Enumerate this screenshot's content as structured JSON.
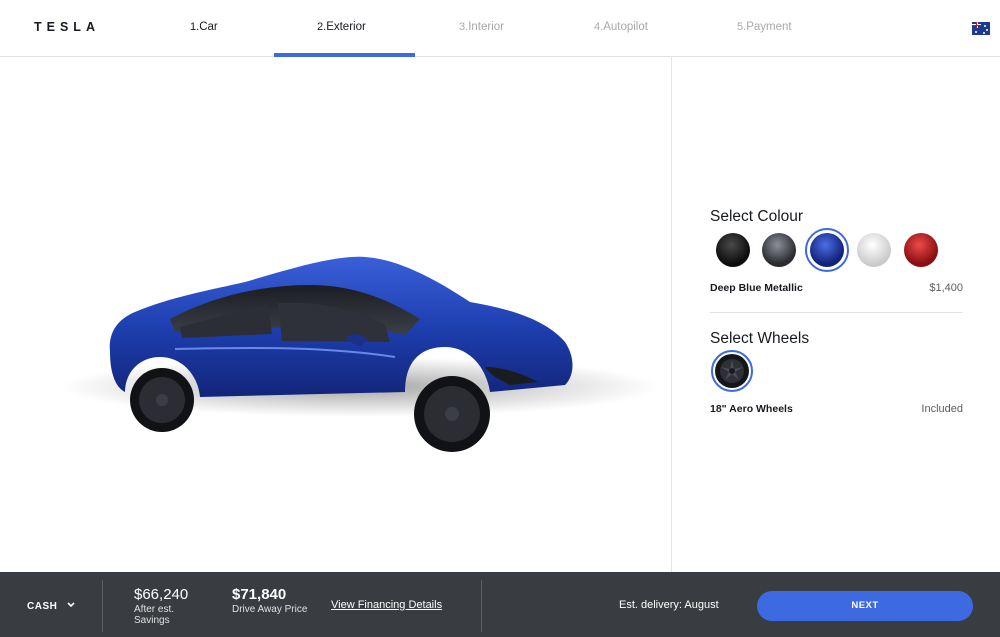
{
  "brand": {
    "logo_text": "TESLA"
  },
  "steps": [
    {
      "num": "1.",
      "label": "Car",
      "state": "done"
    },
    {
      "num": "2.",
      "label": "Exterior",
      "state": "active"
    },
    {
      "num": "3.",
      "label": "Interior",
      "state": "pending"
    },
    {
      "num": "4.",
      "label": "Autopilot",
      "state": "pending"
    },
    {
      "num": "5.",
      "label": "Payment",
      "state": "pending"
    }
  ],
  "region": {
    "icon": "australia-flag-icon"
  },
  "colour": {
    "title": "Select Colour",
    "options": [
      {
        "name": "black",
        "hex": "#1a1a1a"
      },
      {
        "name": "midnight-silver",
        "hex": "#4a4d54"
      },
      {
        "name": "deep-blue",
        "hex": "#1f3ea6"
      },
      {
        "name": "white",
        "hex": "#e8e8e8"
      },
      {
        "name": "red",
        "hex": "#b01a1a"
      }
    ],
    "selected_name": "Deep Blue Metallic",
    "selected_price": "$1,400"
  },
  "wheels": {
    "title": "Select Wheels",
    "selected_name": "18\" Aero Wheels",
    "selected_price": "Included"
  },
  "footer": {
    "payment_mode": "CASH",
    "after_savings_price": "$66,240",
    "after_savings_label_1": "After est.",
    "after_savings_label_2": "Savings",
    "drive_away_price": "$71,840",
    "drive_away_label": "Drive Away Price",
    "financing_link": "View Financing Details",
    "delivery": "Est. delivery: August",
    "next_label": "NEXT"
  },
  "colors": {
    "accent": "#3e6ae1",
    "footer_bg": "#393c41"
  }
}
